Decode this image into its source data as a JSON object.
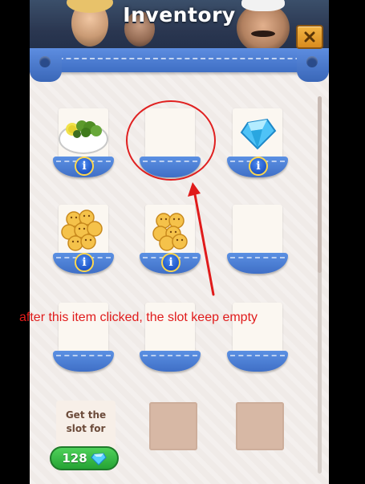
{
  "header": {
    "title": "Inventory",
    "close_icon": "close-icon"
  },
  "colors": {
    "accent_blue": "#3f6fc6",
    "close_orange": "#e09a2a",
    "buy_green": "#2fb03c",
    "annotation_red": "#e01b1b"
  },
  "slots": [
    {
      "row": 1,
      "col": 1,
      "item": "salad-bowl-icon",
      "info": "i"
    },
    {
      "row": 1,
      "col": 2,
      "item": "empty-slot",
      "info": ""
    },
    {
      "row": 1,
      "col": 3,
      "item": "diamond-icon",
      "info": "i"
    },
    {
      "row": 2,
      "col": 1,
      "item": "cookies-icon",
      "info": "i"
    },
    {
      "row": 2,
      "col": 2,
      "item": "cookies-icon",
      "info": "i"
    },
    {
      "row": 2,
      "col": 3,
      "item": "empty-slot",
      "info": ""
    },
    {
      "row": 3,
      "col": 1,
      "item": "empty-slot",
      "info": ""
    },
    {
      "row": 3,
      "col": 2,
      "item": "empty-slot",
      "info": ""
    },
    {
      "row": 3,
      "col": 3,
      "item": "empty-slot",
      "info": ""
    }
  ],
  "unlock": {
    "line1": "Get the",
    "line2": "slot for",
    "price": "128",
    "currency_icon": "diamond-icon"
  },
  "annotation": {
    "text": "after this item clicked, the slot keep empty"
  }
}
